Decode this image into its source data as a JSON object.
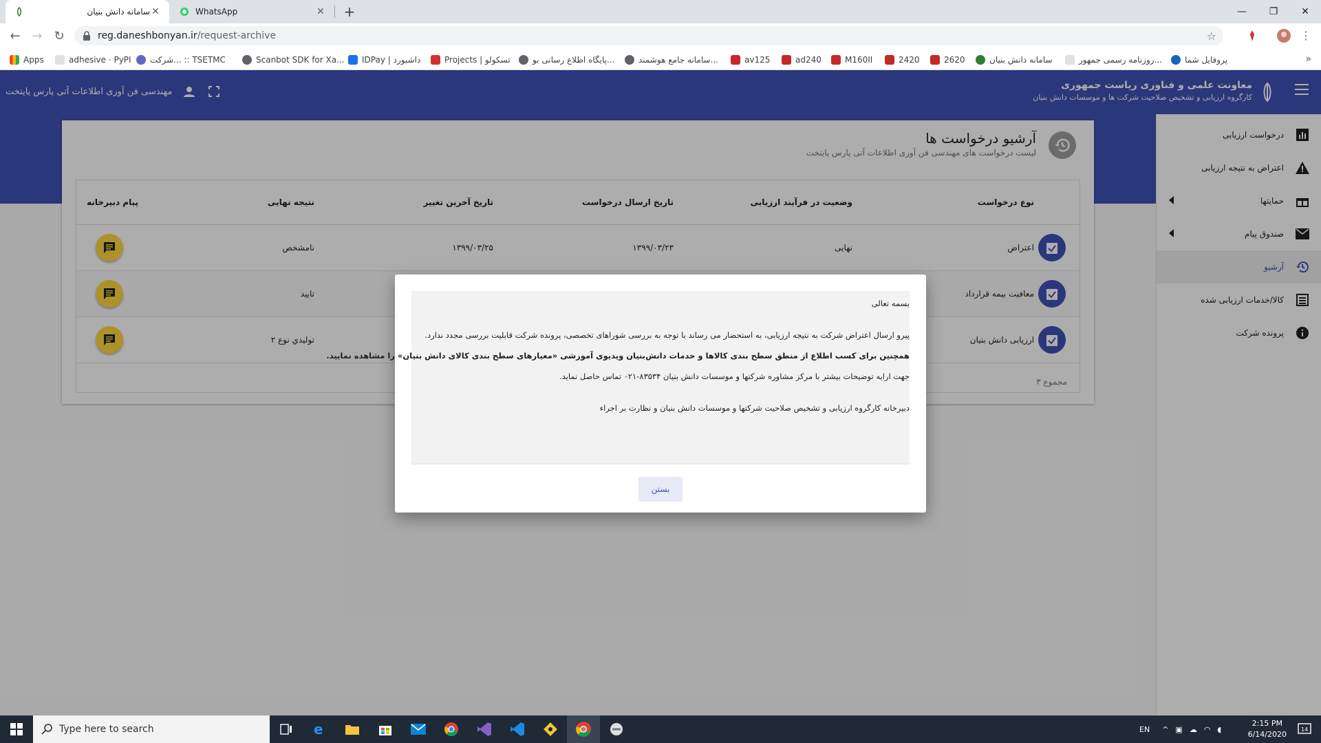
{
  "browser": {
    "tabs": [
      {
        "title": "سامانه دانش بنیان",
        "active": true
      },
      {
        "title": "WhatsApp",
        "active": false
      }
    ],
    "address": {
      "host": "reg.daneshbonyan.ir",
      "path": "/request-archive"
    },
    "bookmarks": [
      "Apps",
      "adhesive · PyPI",
      "شرکت... :: TSETMC",
      "Scanbot SDK for Xa...",
      "IDPay | داشبورد",
      "Projects | تسکولو",
      "پایگاه اطلاع رسانی بو...",
      "سامانه جامع هوشمند...",
      "av125",
      "ad240",
      "M160II",
      "2420",
      "2620",
      "سامانه دانش بنیان",
      "روزنامه رسمی جمهور...",
      "پروفایل شما"
    ]
  },
  "appbar": {
    "title": "معاونت علمی و فناوری ریاست جمهوری",
    "subtitle": "کارگروه ارزیابی و تشخیص صلاحیت شرکت ها و موسسات دانش بنیان",
    "company": "مهندسی فن آوری اطلاعات آتی پارس پایتخت"
  },
  "sidebar": {
    "items": [
      {
        "label": "درخواست ارزیابی",
        "icon": "bar-chart-icon"
      },
      {
        "label": "اعتراض به نتیجه ارزیابی",
        "icon": "warning-icon"
      },
      {
        "label": "حمایتها",
        "icon": "gift-icon"
      },
      {
        "label": "صندوق پیام",
        "icon": "mail-icon"
      },
      {
        "label": "آرشیو",
        "icon": "history-icon"
      },
      {
        "label": "کالا/خدمات ارزیابی شده",
        "icon": "list-icon"
      },
      {
        "label": "پرونده شرکت",
        "icon": "info-icon"
      }
    ]
  },
  "card": {
    "title": "آرشیو درخواست ها",
    "subtitle": "لیست درخواست های مهندسی فن آوری اطلاعات آتی پارس پایتخت"
  },
  "table": {
    "headers": {
      "type": "نوع درخواست",
      "status": "وضعیت در فرآیند ارزیابی",
      "sent": "تاریخ ارسال درخواست",
      "changed": "تاریخ آخرین تغییر",
      "result": "نتیجه نهایی",
      "message": "پیام دبیرخانه"
    },
    "rows": [
      {
        "type": "اعتراض",
        "status": "نهایی",
        "sent": "۱۳۹۹/۰۳/۲۳",
        "changed": "۱۳۹۹/۰۳/۲۵",
        "result": "نامشخص"
      },
      {
        "type": "معافیت بیمه قرارداد",
        "status": "",
        "sent": "",
        "changed": "",
        "result": "تایید"
      },
      {
        "type": "ارزیابی دانش بنیان",
        "status": "",
        "sent": "",
        "changed": "",
        "result": "توليدي نوع ۲"
      }
    ],
    "total": "۳ مجموع"
  },
  "dialog": {
    "greeting": "بسمه تعالی",
    "line1": "پیرو ارسال اعتراض شرکت به نتیجه ارزیابی، به استحضار می رساند با توجه به بررسی شوراهای تخصصی، پرونده شرکت قابلیت بررسی مجدد ندارد.",
    "line2": "همچنین برای کسب اطلاع از منطق سطح بندی کالاها و خدمات دانش‌بنیان ویدیوی آموزشی «معیارهای سطح بندی کالای دانش بنیان» را مشاهده نمایید.",
    "line3": "جهت ارایه توضیحات بیشتر با مرکز مشاوره شرکتها و موسسات دانش بنیان  ۸۳۵۳۴-۰۲۱ تماس حاصل نماید.",
    "signature": "دبیرخانه کارگروه ارزیابی و تشخیص صلاحیت شرکتها و موسسات دانش بنیان و نظارت بر اجراء",
    "close": "بستن"
  },
  "taskbar": {
    "search_placeholder": "Type here to search",
    "lang": "EN",
    "time": "2:15 PM",
    "date": "6/14/2020",
    "notif_count": "14"
  },
  "colors": {
    "primary": "#3f51b5",
    "accent": "#ffd740"
  }
}
